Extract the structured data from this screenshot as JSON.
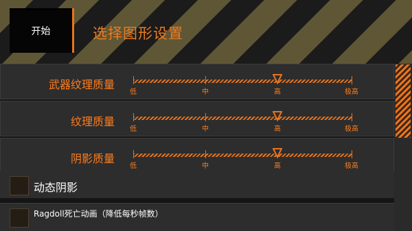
{
  "header": {
    "start_label": "开始",
    "title": "选择图形设置"
  },
  "sliders": [
    {
      "label": "武器纹理质量",
      "ticks": [
        "低",
        "中",
        "高",
        "极高"
      ],
      "selected": "高"
    },
    {
      "label": "纹理质量",
      "ticks": [
        "低",
        "中",
        "高",
        "极高"
      ],
      "selected": "高"
    },
    {
      "label": "阴影质量",
      "ticks": [
        "低",
        "中",
        "高",
        "极高"
      ],
      "selected": "高"
    }
  ],
  "toggles": [
    {
      "label": "动态阴影",
      "checked": false
    },
    {
      "label": "Ragdoll死亡动画（降低每秒帧数）",
      "checked": false
    }
  ],
  "colors": {
    "accent": "#e8741f",
    "label": "#ff7d1e",
    "row_bg": "#2d2d2d"
  }
}
